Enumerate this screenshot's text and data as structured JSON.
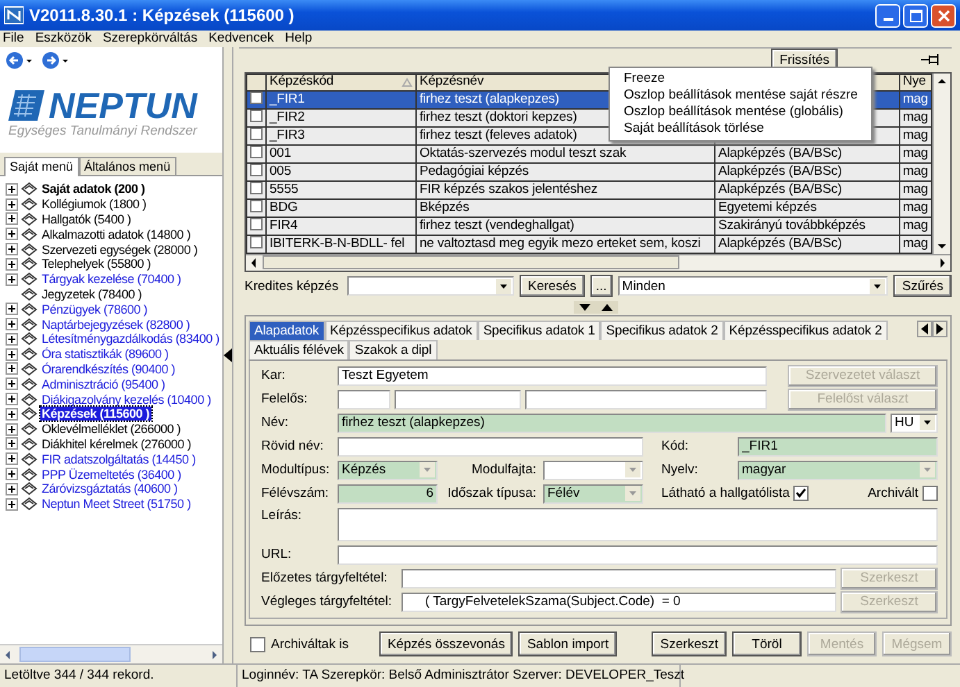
{
  "window": {
    "title": "V2011.8.30.1 : Képzések (115600 )"
  },
  "menu": [
    "File",
    "Eszközök",
    "Szerepkörváltás",
    "Kedvencek",
    "Help"
  ],
  "logo": {
    "name": "NEPTUN",
    "tagline": "Egységes Tanulmányi Rendszer"
  },
  "sidebar": {
    "tabs": [
      {
        "label": "Saját menü",
        "selected": true
      },
      {
        "label": "Általános menü",
        "selected": false
      }
    ],
    "items": [
      {
        "label": "Saját adatok (200  )",
        "color": "#000000",
        "bold": true,
        "expandable": true,
        "selected": false
      },
      {
        "label": "Kollégiumok (1800  )",
        "color": "#000000",
        "bold": false,
        "expandable": true,
        "selected": false
      },
      {
        "label": "Hallgatók (5400  )",
        "color": "#000000",
        "bold": false,
        "expandable": true,
        "selected": false
      },
      {
        "label": "Alkalmazotti adatok (14800  )",
        "color": "#000000",
        "bold": false,
        "expandable": true,
        "selected": false
      },
      {
        "label": "Szervezeti egységek (28000  )",
        "color": "#000000",
        "bold": false,
        "expandable": true,
        "selected": false
      },
      {
        "label": "Telephelyek (55800  )",
        "color": "#000000",
        "bold": false,
        "expandable": true,
        "selected": false
      },
      {
        "label": "Tárgyak kezelése (70400  )",
        "color": "#1c1cdc",
        "bold": false,
        "expandable": true,
        "selected": false
      },
      {
        "label": "Jegyzetek (78400  )",
        "color": "#000000",
        "bold": false,
        "expandable": false,
        "selected": false
      },
      {
        "label": "Pénzügyek (78600  )",
        "color": "#1c1cdc",
        "bold": false,
        "expandable": true,
        "selected": false
      },
      {
        "label": "Naptárbejegyzések (82800  )",
        "color": "#1c1cdc",
        "bold": false,
        "expandable": true,
        "selected": false
      },
      {
        "label": "Létesítménygazdálkodás (83400  )",
        "color": "#1c1cdc",
        "bold": false,
        "expandable": true,
        "selected": false
      },
      {
        "label": "Óra statisztikák (89600  )",
        "color": "#1c1cdc",
        "bold": false,
        "expandable": true,
        "selected": false
      },
      {
        "label": "Órarendkészítés (90400  )",
        "color": "#1c1cdc",
        "bold": false,
        "expandable": true,
        "selected": false
      },
      {
        "label": "Adminisztráció (95400  )",
        "color": "#1c1cdc",
        "bold": false,
        "expandable": true,
        "selected": false
      },
      {
        "label": "Diákigazolvány kezelés (10400  )",
        "color": "#1c1cdc",
        "bold": false,
        "expandable": true,
        "selected": false
      },
      {
        "label": "Képzések (115600  )",
        "color": "#1c1cdc",
        "bold": true,
        "expandable": true,
        "selected": true
      },
      {
        "label": "Oklevélmelléklet (266000  )",
        "color": "#000000",
        "bold": false,
        "expandable": true,
        "selected": false
      },
      {
        "label": "Diákhitel kérelmek (276000  )",
        "color": "#000000",
        "bold": false,
        "expandable": true,
        "selected": false
      },
      {
        "label": "FIR adatszolgáltatás (14450  )",
        "color": "#1c1cdc",
        "bold": false,
        "expandable": true,
        "selected": false
      },
      {
        "label": "PPP Üzemeltetés (36400  )",
        "color": "#1c1cdc",
        "bold": false,
        "expandable": true,
        "selected": false
      },
      {
        "label": "Záróvizsgáztatás (40600  )",
        "color": "#1c1cdc",
        "bold": false,
        "expandable": true,
        "selected": false
      },
      {
        "label": "Neptun Meet Street (51750  )",
        "color": "#1c1cdc",
        "bold": false,
        "expandable": true,
        "selected": false
      }
    ]
  },
  "toolbar": {
    "refresh": "Frissítés"
  },
  "table": {
    "columns": {
      "code": "Képzéskód",
      "name": "Képzésnév",
      "column_4": "Nye"
    },
    "sorted": true,
    "rows": [
      {
        "selected": true,
        "checked": false,
        "code": "_FIR1",
        "name": "firhez teszt (alapkepzes)",
        "lang": "mag"
      },
      {
        "selected": false,
        "checked": false,
        "code": "_FIR2",
        "name": "firhez teszt (doktori kepzes)",
        "lang": "mag"
      },
      {
        "selected": false,
        "checked": false,
        "code": "_FIR3",
        "name": "firhez teszt (feleves adatok)",
        "lang": "mag"
      },
      {
        "selected": false,
        "checked": false,
        "code": "001",
        "name": "Oktatás-szervezés modul teszt szak",
        "type": "Alapképzés (BA/BSc)",
        "lang": "mag"
      },
      {
        "selected": false,
        "checked": false,
        "code": "005",
        "name": "Pedagógiai képzés",
        "type": "Alapképzés (BA/BSc)",
        "lang": "mag"
      },
      {
        "selected": false,
        "checked": false,
        "code": "5555",
        "name": "FIR képzés szakos jelentéshez",
        "type": "Alapképzés (BA/BSc)",
        "lang": "mag"
      },
      {
        "selected": false,
        "checked": false,
        "code": "BDG",
        "name": "Bképzés",
        "type": "Egyetemi képzés",
        "lang": "mag"
      },
      {
        "selected": false,
        "checked": false,
        "code": "FIR4",
        "name": "firhez teszt (vendeghallgat)",
        "type": "Szakirányú továbbképzés",
        "lang": "mag"
      },
      {
        "selected": false,
        "checked": false,
        "code": "IBITERK-B-N-BDLL- fel",
        "name": "ne valtoztasd meg egyik mezo erteket sem, koszi",
        "type": "Alapképzés (BA/BSc)",
        "lang": "mag"
      }
    ]
  },
  "context_menu": [
    "Freeze",
    "Oszlop beállítások mentése saját részre",
    "Oszlop beállítások mentése (globális)",
    "Saját beállítások törlése"
  ],
  "filter": {
    "label": "Kredites képzés",
    "search": "Keresés",
    "more": "...",
    "scope": "Minden",
    "apply": "Szűrés"
  },
  "tabs": [
    {
      "label": "Alapadatok",
      "selected": true
    },
    {
      "label": "Képzésspecifikus adatok",
      "selected": false
    },
    {
      "label": "Specifikus adatok 1",
      "selected": false
    },
    {
      "label": "Specifikus adatok 2",
      "selected": false
    },
    {
      "label": "Képzésspecifikus adatok 2",
      "selected": false
    },
    {
      "label": "Aktuális félévek",
      "selected": false
    },
    {
      "label": "Szakok a dipl",
      "selected": false
    }
  ],
  "form": {
    "kar": {
      "label": "Kar:",
      "value": "Teszt Egyetem",
      "required": false,
      "button": {
        "label": "Szervezetet választ",
        "disabled": true
      }
    },
    "felelos": {
      "label": "Felelős:",
      "button": {
        "label": "Felelőst választ",
        "disabled": true
      }
    },
    "nev": {
      "label": "Név:",
      "value": "firhez teszt (alapkepzes)",
      "required": true,
      "language": "HU"
    },
    "rovid_nev": {
      "label": "Rövid név:",
      "required": false
    },
    "kod": {
      "label": "Kód:",
      "value": "_FIR1",
      "required": true
    },
    "modultipus": {
      "label": "Modultípus:",
      "value": "Képzés",
      "required": true
    },
    "modulfajta": {
      "label": "Modulfajta:",
      "required": false
    },
    "nyelv": {
      "label": "Nyelv:",
      "value": "magyar",
      "required": true
    },
    "felevszam": {
      "label": "Félévszám:",
      "value": "6",
      "required": true
    },
    "idoszak": {
      "label": "Időszak típusa:",
      "value": "Félév",
      "required": true
    },
    "lathato": {
      "label": "Látható a hallgatólista",
      "checked": true
    },
    "archivalt": {
      "label": "Archivált",
      "checked": false
    },
    "leiras": {
      "label": "Leírás:"
    },
    "url": {
      "label": "URL:"
    },
    "elozetes": {
      "label": "Előzetes tárgyfeltétel:",
      "button": {
        "label": "Szerkeszt",
        "disabled": true
      }
    },
    "vegleges": {
      "label": "Végleges tárgyfeltétel:",
      "value": "( TargyFelvetelekSzama(Subject.Code)  = 0",
      "button": {
        "label": "Szerkeszt",
        "disabled": true
      }
    }
  },
  "bottom": {
    "archived": {
      "label": "Archiváltak is",
      "checked": false
    },
    "left_buttons": [
      {
        "label": "Képzés összevonás",
        "disabled": false
      },
      {
        "label": "Sablon import",
        "disabled": false
      }
    ],
    "right_buttons": [
      {
        "label": "Szerkeszt",
        "disabled": false
      },
      {
        "label": "Töröl",
        "disabled": false
      },
      {
        "label": "Mentés",
        "disabled": true
      },
      {
        "label": "Mégsem",
        "disabled": true
      }
    ]
  },
  "status_bar": {
    "records": "Letöltve 344 / 344 rekord.",
    "session": "Loginnév: TA   Szerepkör: Belső Adminisztrátor   Szerver: DEVELOPER_Teszt"
  }
}
